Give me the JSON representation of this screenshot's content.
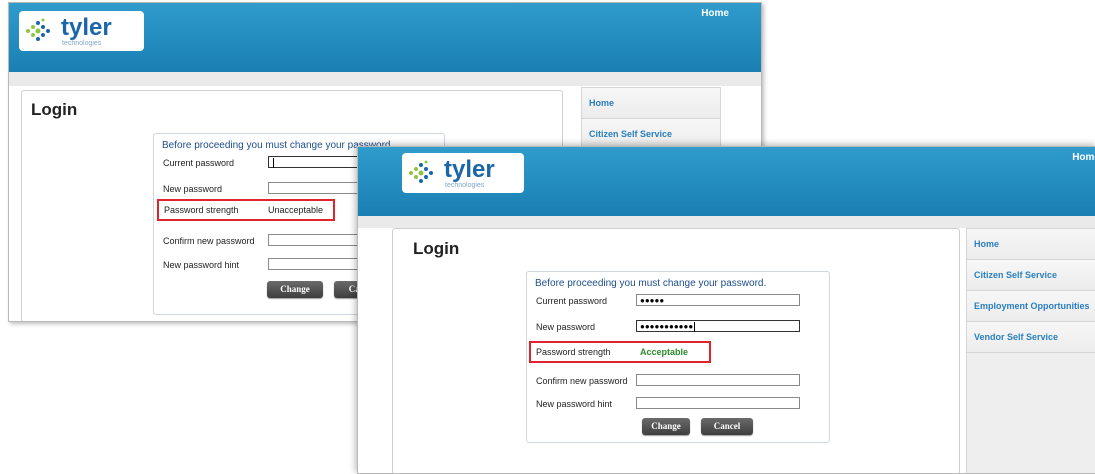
{
  "colors": {
    "banner": "#1f8bc0",
    "unacceptable": "#222222",
    "acceptable": "#2e8b2e",
    "highlight_box": "#e0242c",
    "link": "#2a7fbf"
  },
  "screen1": {
    "logo": {
      "word": "tyler",
      "sub": "technologies"
    },
    "home_link": "Home",
    "title": "Login",
    "form": {
      "heading": "Before proceeding you must change your password.",
      "labels": {
        "current": "Current password",
        "new": "New password",
        "strength": "Password strength",
        "confirm": "Confirm new password",
        "hint": "New password hint"
      },
      "values": {
        "current": "",
        "new": "",
        "confirm": "",
        "hint": ""
      },
      "strength_value": "Unacceptable",
      "buttons": {
        "change": "Change",
        "cancel": "Cancel"
      }
    },
    "sidebar": [
      "Home",
      "Citizen Self Service"
    ]
  },
  "screen2": {
    "logo": {
      "word": "tyler",
      "sub": "technologies"
    },
    "home_link": "Home",
    "title": "Login",
    "form": {
      "heading": "Before proceeding you must change your password.",
      "labels": {
        "current": "Current password",
        "new": "New password",
        "strength": "Password strength",
        "confirm": "Confirm new password",
        "hint": "New password hint"
      },
      "values": {
        "current": "●●●●●",
        "new": "●●●●●●●●●●●",
        "confirm": "",
        "hint": ""
      },
      "strength_value": "Acceptable",
      "buttons": {
        "change": "Change",
        "cancel": "Cancel"
      }
    },
    "sidebar": [
      "Home",
      "Citizen Self Service",
      "Employment Opportunities",
      "Vendor Self Service"
    ]
  }
}
